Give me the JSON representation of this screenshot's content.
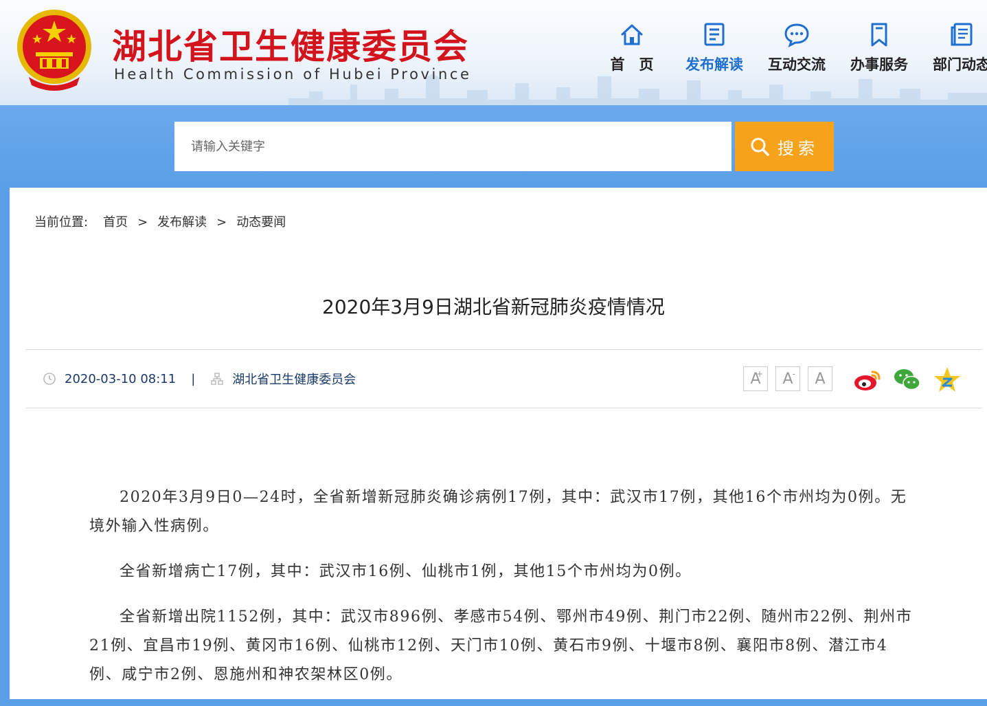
{
  "header": {
    "site_title": "湖北省卫生健康委员会",
    "site_subtitle": "Health Commission of Hubei Province",
    "emblem_icon": "national-emblem-icon",
    "nav": [
      {
        "label": "首　页",
        "icon": "home-icon",
        "active": false
      },
      {
        "label": "发布解读",
        "icon": "document-icon",
        "active": true
      },
      {
        "label": "互动交流",
        "icon": "chat-icon",
        "active": false
      },
      {
        "label": "办事服务",
        "icon": "bookmark-icon",
        "active": false
      },
      {
        "label": "部门动态",
        "icon": "news-icon",
        "active": false
      }
    ]
  },
  "search": {
    "placeholder": "请输入关键字",
    "button_label": "搜索",
    "button_color": "#f7a21b"
  },
  "breadcrumb": {
    "prefix": "当前位置:",
    "items": [
      "首页",
      "发布解读",
      "动态要闻"
    ],
    "separator": ">"
  },
  "article": {
    "title": "2020年3月9日湖北省新冠肺炎疫情情况",
    "date": "2020-03-10 08:11",
    "meta_separator": "|",
    "source": "湖北省卫生健康委员会",
    "font_buttons": [
      "A",
      "A",
      "A"
    ],
    "share_icons": [
      "weibo-icon",
      "wechat-icon",
      "qzone-icon"
    ],
    "paragraphs": [
      "2020年3月9日0—24时，全省新增新冠肺炎确诊病例17例，其中：武汉市17例，其他16个市州均为0例。无境外输入性病例。",
      "全省新增病亡17例，其中：武汉市16例、仙桃市1例，其他15个市州均为0例。",
      "全省新增出院1152例，其中：武汉市896例、孝感市54例、鄂州市49例、荆门市22例、随州市22例、荆州市21例、宜昌市19例、黄冈市16例、仙桃市12例、天门市10例、黄石市9例、十堰市8例、襄阳市8例、潜江市4例、咸宁市2例、恩施州和神农架林区0例。"
    ]
  },
  "colors": {
    "brand_red": "#d3141c",
    "nav_active": "#1e6fd0",
    "band_blue": "#5b9fe8",
    "meta_blue": "#1a3a6b"
  }
}
